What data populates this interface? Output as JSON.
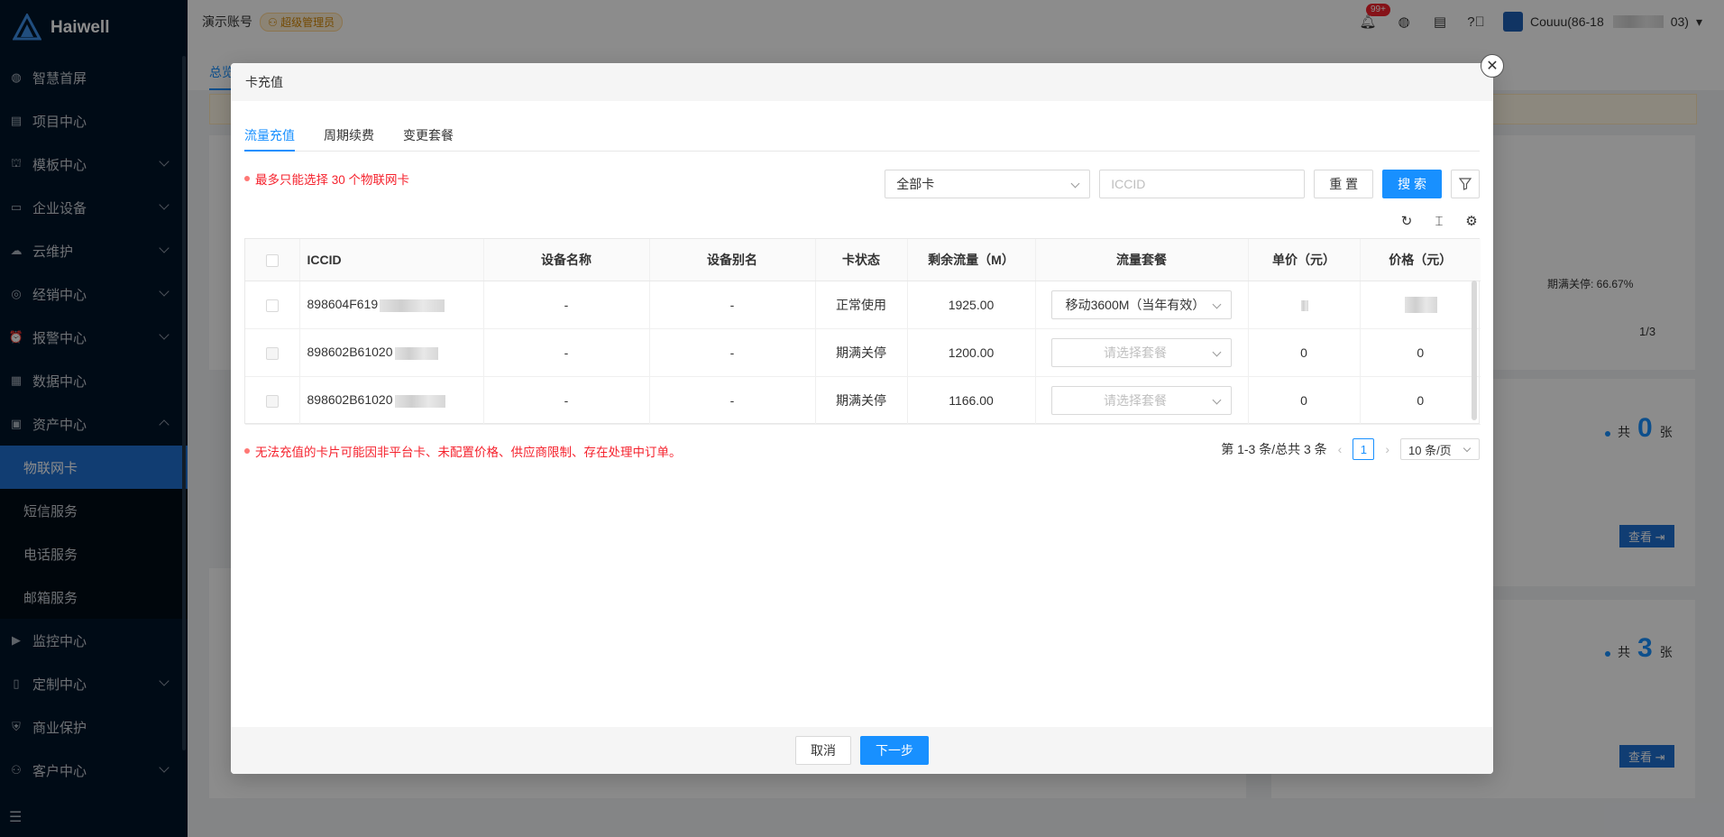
{
  "app": {
    "brand": "Haiwell",
    "brand_sub": "Haiwell"
  },
  "sidebar": {
    "items": [
      {
        "label": "智慧首屏",
        "icon": "globe-icon",
        "chevron": ""
      },
      {
        "label": "项目中心",
        "icon": "list-icon",
        "chevron": ""
      },
      {
        "label": "模板中心",
        "icon": "template-icon",
        "chevron": "down"
      },
      {
        "label": "企业设备",
        "icon": "device-icon",
        "chevron": "down"
      },
      {
        "label": "云维护",
        "icon": "cloud-icon",
        "chevron": "down"
      },
      {
        "label": "经销中心",
        "icon": "dealer-icon",
        "chevron": "down"
      },
      {
        "label": "报警中心",
        "icon": "alarm-icon",
        "chevron": "down"
      },
      {
        "label": "数据中心",
        "icon": "data-icon",
        "chevron": ""
      },
      {
        "label": "资产中心",
        "icon": "asset-icon",
        "chevron": "up"
      }
    ],
    "sub_items": [
      "物联网卡",
      "短信服务",
      "电话服务",
      "邮箱服务"
    ],
    "items_after": [
      {
        "label": "监控中心",
        "icon": "camera-icon",
        "chevron": ""
      },
      {
        "label": "定制中心",
        "icon": "custom-icon",
        "chevron": "down"
      },
      {
        "label": "商业保护",
        "icon": "shield-icon",
        "chevron": ""
      },
      {
        "label": "客户中心",
        "icon": "customer-icon",
        "chevron": "down"
      }
    ]
  },
  "header": {
    "account": "演示账号",
    "role": "超级管理员",
    "notif_count": "99+",
    "user": "Couuu(86-18",
    "user_tail": "03)"
  },
  "background": {
    "tab": "总览",
    "stat1_prefix": "共",
    "stat1_value": "0",
    "stat1_unit": "张",
    "stat2_prefix": "共",
    "stat2_value": "3",
    "stat2_unit": "张",
    "view_label": "查看",
    "pie_label": "期满关停: 66.67%",
    "pager": "1/3"
  },
  "modal": {
    "title": "卡充值",
    "tabs": [
      "流量充值",
      "周期续费",
      "变更套餐"
    ],
    "filter": {
      "select_value": "全部卡",
      "iccid_placeholder": "ICCID",
      "reset_label": "重 置",
      "search_label": "搜 索"
    },
    "max_hint": "最多只能选择 30 个物联网卡",
    "columns": [
      "ICCID",
      "设备名称",
      "设备别名",
      "卡状态",
      "剩余流量（M）",
      "流量套餐",
      "单价（元）",
      "价格（元）"
    ],
    "rows": [
      {
        "iccid": "898604F619",
        "device_name": "-",
        "device_alias": "-",
        "status": "正常使用",
        "remaining": "1925.00",
        "package": "移动3600M（当年有效）",
        "package_empty": false,
        "unit_price": "",
        "price": ""
      },
      {
        "iccid": "898602B61020",
        "device_name": "-",
        "device_alias": "-",
        "status": "期满关停",
        "remaining": "1200.00",
        "package": "请选择套餐",
        "package_empty": true,
        "unit_price": "0",
        "price": "0"
      },
      {
        "iccid": "898602B61020",
        "device_name": "-",
        "device_alias": "-",
        "status": "期满关停",
        "remaining": "1166.00",
        "package": "请选择套餐",
        "package_empty": true,
        "unit_price": "0",
        "price": "0"
      }
    ],
    "bottom_hint": "无法充值的卡片可能因非平台卡、未配置价格、供应商限制、存在处理中订单。",
    "pagination": {
      "summary": "第 1-3 条/总共 3 条",
      "current": "1",
      "page_size": "10 条/页"
    },
    "footer": {
      "cancel_label": "取消",
      "next_label": "下一步"
    }
  },
  "colors": {
    "primary": "#1890ff",
    "sidebar_bg": "#001529",
    "danger": "#f5222d"
  }
}
